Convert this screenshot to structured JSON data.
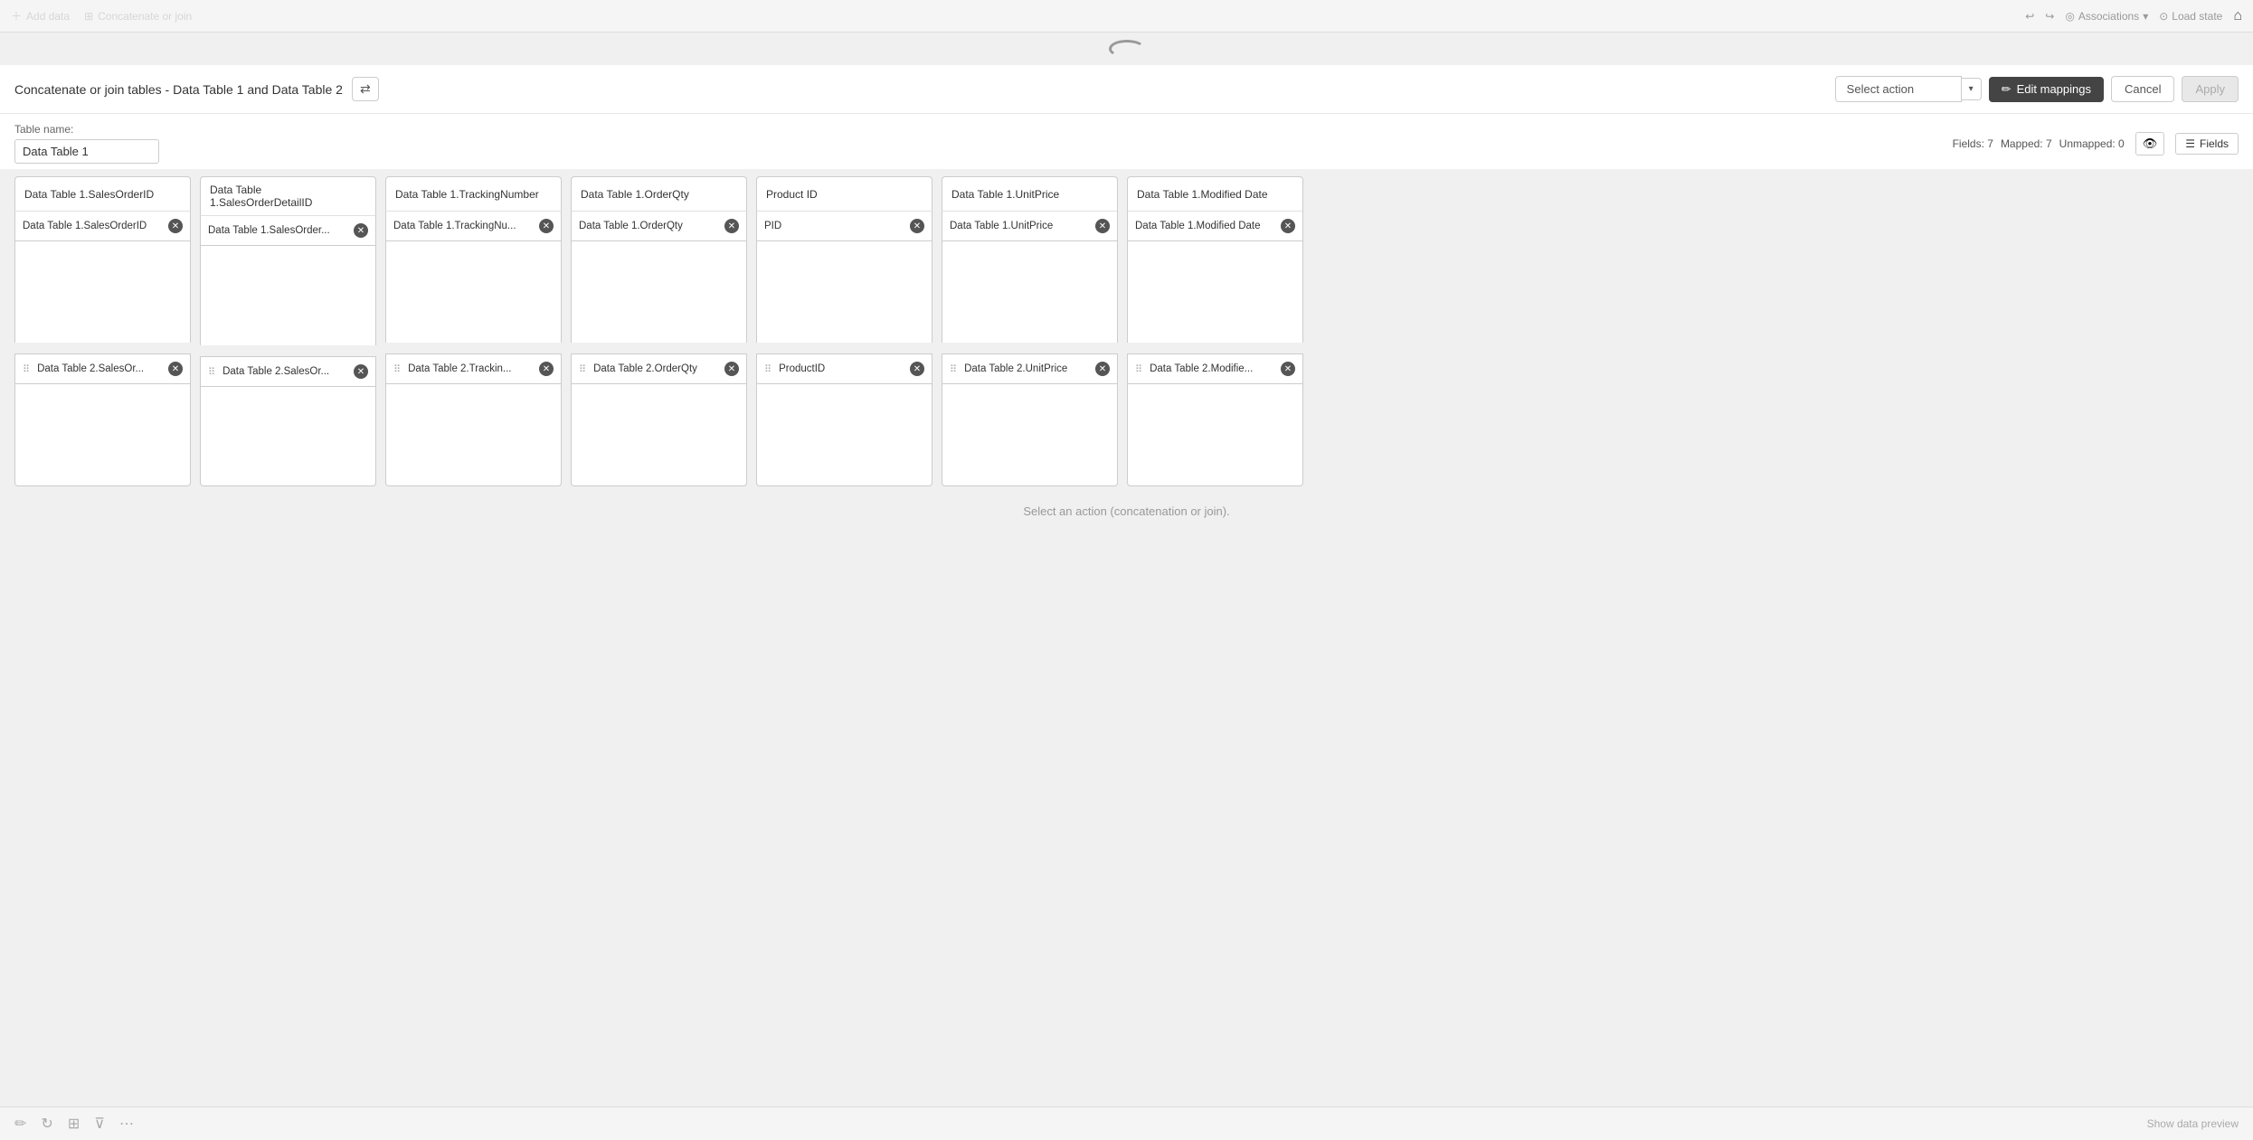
{
  "topnav": {
    "add_data": "Add data",
    "concat_join": "Concatenate or join",
    "undo_icon": "↩",
    "redo_icon": "↪",
    "associations_label": "Associations",
    "load_state": "Load state",
    "home_icon": "⌂"
  },
  "header": {
    "title": "Concatenate or join tables - Data Table 1 and Data Table 2",
    "swap_icon": "⇄",
    "select_action_label": "Select action",
    "edit_mappings_label": "Edit mappings",
    "edit_icon": "✏",
    "cancel_label": "Cancel",
    "apply_label": "Apply"
  },
  "table_name": {
    "label": "Table name:",
    "value": "Data Table 1",
    "fields_label": "Fields: 7",
    "mapped_label": "Mapped: 7",
    "unmapped_label": "Unmapped: 0",
    "eye_icon": "👁",
    "fields_btn": "Fields",
    "list_icon": "☰"
  },
  "columns": [
    {
      "id": "col1",
      "header": "Data Table 1.SalesOrderID",
      "source1": "Data Table 1.SalesOrderID",
      "source2": "Data Table 2.SalesOr..."
    },
    {
      "id": "col2",
      "header": "Data Table 1.SalesOrderDetailID",
      "source1": "Data Table 1.SalesOrder...",
      "source2": "Data Table 2.SalesOr..."
    },
    {
      "id": "col3",
      "header": "Data Table 1.TrackingNumber",
      "source1": "Data Table 1.TrackingNu...",
      "source2": "Data Table 2.Trackin..."
    },
    {
      "id": "col4",
      "header": "Data Table 1.OrderQty",
      "source1": "Data Table 1.OrderQty",
      "source2": "Data Table 2.OrderQty"
    },
    {
      "id": "col5",
      "header": "Product ID",
      "source1": "PID",
      "source2": "ProductID"
    },
    {
      "id": "col6",
      "header": "Data Table 1.UnitPrice",
      "source1": "Data Table 1.UnitPrice",
      "source2": "Data Table 2.UnitPrice"
    },
    {
      "id": "col7",
      "header": "Data Table 1.Modified Date",
      "source1": "Data Table 1.Modified Date",
      "source2": "Data Table 2.Modifie..."
    }
  ],
  "bottom": {
    "status_text": "Select an action (concatenation or join).",
    "show_data_preview": "Show data preview"
  }
}
